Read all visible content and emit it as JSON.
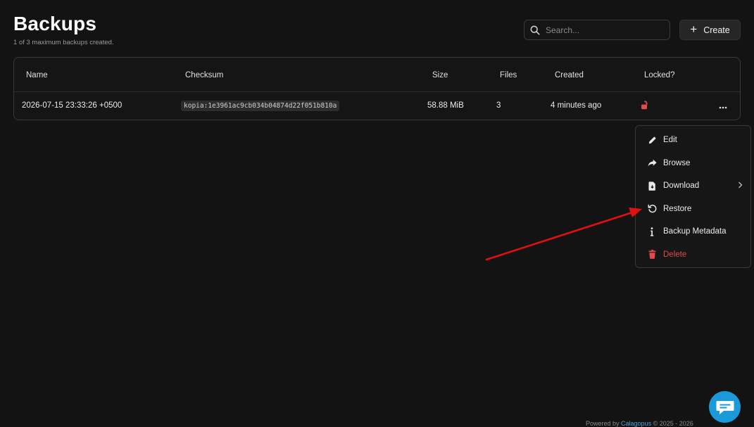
{
  "header": {
    "title": "Backups",
    "subtitle": "1 of 3 maximum backups created."
  },
  "search": {
    "placeholder": "Search..."
  },
  "toolbar": {
    "create_label": "Create"
  },
  "table": {
    "columns": [
      "Name",
      "Checksum",
      "Size",
      "Files",
      "Created",
      "Locked?"
    ],
    "rows": [
      {
        "name": "2026-07-15 23:33:26 +0500",
        "checksum": "kopia:1e3961ac9cb034b04874d22f051b810a",
        "size": "58.88 MiB",
        "files": "3",
        "created": "4 minutes ago",
        "locked_icon": "unlocked-padlock-icon"
      }
    ]
  },
  "context_menu": {
    "items": [
      {
        "label": "Edit",
        "icon": "pencil-icon"
      },
      {
        "label": "Browse",
        "icon": "share-arrow-icon"
      },
      {
        "label": "Download",
        "icon": "file-download-icon",
        "has_submenu": true
      },
      {
        "label": "Restore",
        "icon": "restore-icon"
      },
      {
        "label": "Backup Metadata",
        "icon": "info-icon"
      },
      {
        "label": "Delete",
        "icon": "trash-icon",
        "danger": true
      }
    ]
  },
  "footer": {
    "prefix": "Powered by ",
    "brand": "Calagopus",
    "suffix": " © 2025 - 2026"
  },
  "colors": {
    "background": "#131313",
    "danger": "#e5484d",
    "annotation_arrow": "#e01010",
    "chat_bubble": "#1a9ad9"
  }
}
